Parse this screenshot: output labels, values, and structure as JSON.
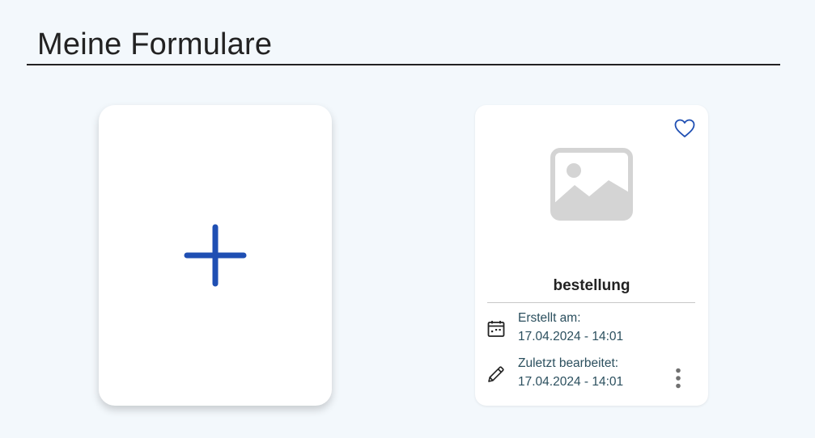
{
  "header": {
    "title": "Meine Formulare"
  },
  "add_card": {
    "icon": "plus-icon",
    "accent": "#1f4fb3"
  },
  "forms": [
    {
      "name": "bestellung",
      "thumbnail_icon": "image-placeholder-icon",
      "favorite_icon": "heart-outline-icon",
      "created_label": "Erstellt am:",
      "created_value": "17.04.2024 - 14:01",
      "edited_label": "Zuletzt bearbeitet:",
      "edited_value": "17.04.2024 - 14:01",
      "menu_icon": "more-vertical-icon"
    }
  ],
  "colors": {
    "background": "#f3f8fc",
    "accent": "#1f4fb3",
    "meta_text": "#2b4f5e",
    "placeholder": "#d4d4d4"
  }
}
